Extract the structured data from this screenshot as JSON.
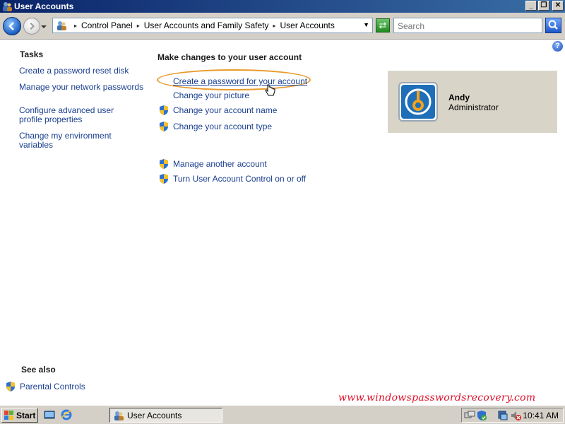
{
  "window": {
    "title": "User Accounts"
  },
  "address": {
    "crumbs": [
      "Control Panel",
      "User Accounts and Family Safety",
      "User Accounts"
    ],
    "search_placeholder": "Search"
  },
  "left": {
    "tasks_heading": "Tasks",
    "tasks": [
      "Create a password reset disk",
      "Manage your network passwords",
      "Configure advanced user profile properties",
      "Change my environment variables"
    ],
    "see_also_heading": "See also",
    "parental_controls": "Parental Controls"
  },
  "main": {
    "heading": "Make changes to your user account",
    "actions": [
      "Create a password for your account",
      "Change your picture",
      "Change your account name",
      "Change your account type",
      "Manage another account",
      "Turn User Account Control on or off"
    ]
  },
  "account": {
    "name": "Andy",
    "role": "Administrator"
  },
  "watermark": "www.windowspasswordsrecovery.com",
  "taskbar": {
    "start_label": "Start",
    "task_label": "User Accounts",
    "clock": "10:41 AM"
  },
  "colors": {
    "link": "#1a3f8f",
    "highlight_oval": "#e89a2a",
    "watermark": "#e0102a",
    "tile_bg": "#d8d4c8"
  }
}
